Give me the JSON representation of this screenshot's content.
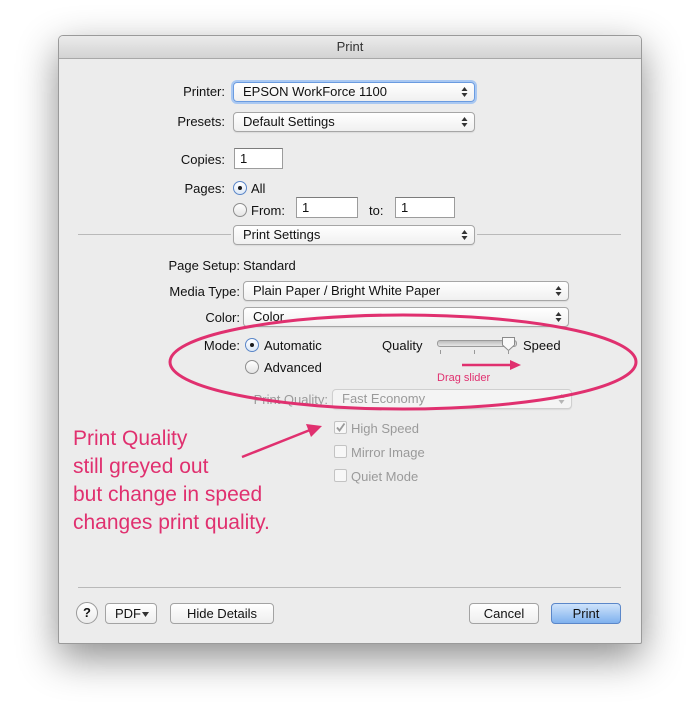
{
  "window": {
    "title": "Print"
  },
  "printer": {
    "label": "Printer:",
    "value": "EPSON WorkForce 1100"
  },
  "presets": {
    "label": "Presets:",
    "value": "Default Settings"
  },
  "copies": {
    "label": "Copies:",
    "value": "1"
  },
  "pages": {
    "label": "Pages:",
    "all_label": "All",
    "from_label": "From:",
    "from_value": "1",
    "to_label": "to:",
    "to_value": "1",
    "selected": "All"
  },
  "section": {
    "value": "Print Settings"
  },
  "page_setup": {
    "label": "Page Setup:",
    "value": "Standard"
  },
  "media_type": {
    "label": "Media Type:",
    "value": "Plain Paper / Bright White Paper"
  },
  "color": {
    "label": "Color:",
    "value": "Color"
  },
  "mode": {
    "label": "Mode:",
    "automatic_label": "Automatic",
    "advanced_label": "Advanced",
    "selected": "Automatic"
  },
  "quality_slider": {
    "left_label": "Quality",
    "right_label": "Speed",
    "position": 1.0
  },
  "print_quality": {
    "label": "Print Quality:",
    "value": "Fast Economy"
  },
  "options": [
    {
      "label": "High Speed",
      "checked": true
    },
    {
      "label": "Mirror Image",
      "checked": false
    },
    {
      "label": "Quiet Mode",
      "checked": false
    }
  ],
  "footer": {
    "help_label": "?",
    "pdf_label": "PDF",
    "hide_details_label": "Hide Details",
    "cancel_label": "Cancel",
    "print_label": "Print"
  },
  "annotations": {
    "drag_label": "Drag slider",
    "note_lines": [
      "Print Quality",
      "still greyed out",
      "but change in speed",
      "changes print quality."
    ],
    "color": "#e0306f"
  },
  "colors": {
    "accent": "#5b87c9",
    "annotation": "#e0306f",
    "window_bg": "#ececec"
  }
}
